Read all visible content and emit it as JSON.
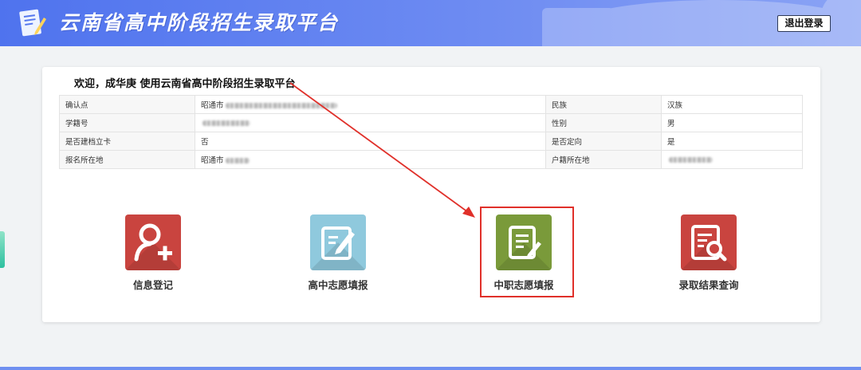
{
  "header": {
    "title": "云南省高中阶段招生录取平台",
    "logout_label": "退出登录",
    "logo_icon": "document-pen-icon",
    "color": "#5577ee"
  },
  "card": {
    "welcome": "欢迎，成华庚 使用云南省高中阶段招生录取平台",
    "rows": [
      {
        "label_a": "确认点",
        "value_a": "昭通市",
        "label_b": "民族",
        "value_b": "汉族"
      },
      {
        "label_a": "学籍号",
        "value_a": "",
        "label_b": "性别",
        "value_b": "男"
      },
      {
        "label_a": "是否建档立卡",
        "value_a": "否",
        "label_b": "是否定向",
        "value_b": "是"
      },
      {
        "label_a": "报名所在地",
        "value_a": "昭通市",
        "label_b": "户籍所在地",
        "value_b": ""
      }
    ]
  },
  "tiles": [
    {
      "label": "信息登记",
      "icon": "user-add-icon",
      "color": "#c9443f"
    },
    {
      "label": "高中志愿填报",
      "icon": "edit-form-icon",
      "color": "#8fc9dd"
    },
    {
      "label": "中职志愿填报",
      "icon": "document-edit-icon",
      "color": "#7a9a3a"
    },
    {
      "label": "录取结果查询",
      "icon": "search-document-icon",
      "color": "#c9443f"
    }
  ],
  "annotation": {
    "highlight_color": "#e0302a"
  }
}
